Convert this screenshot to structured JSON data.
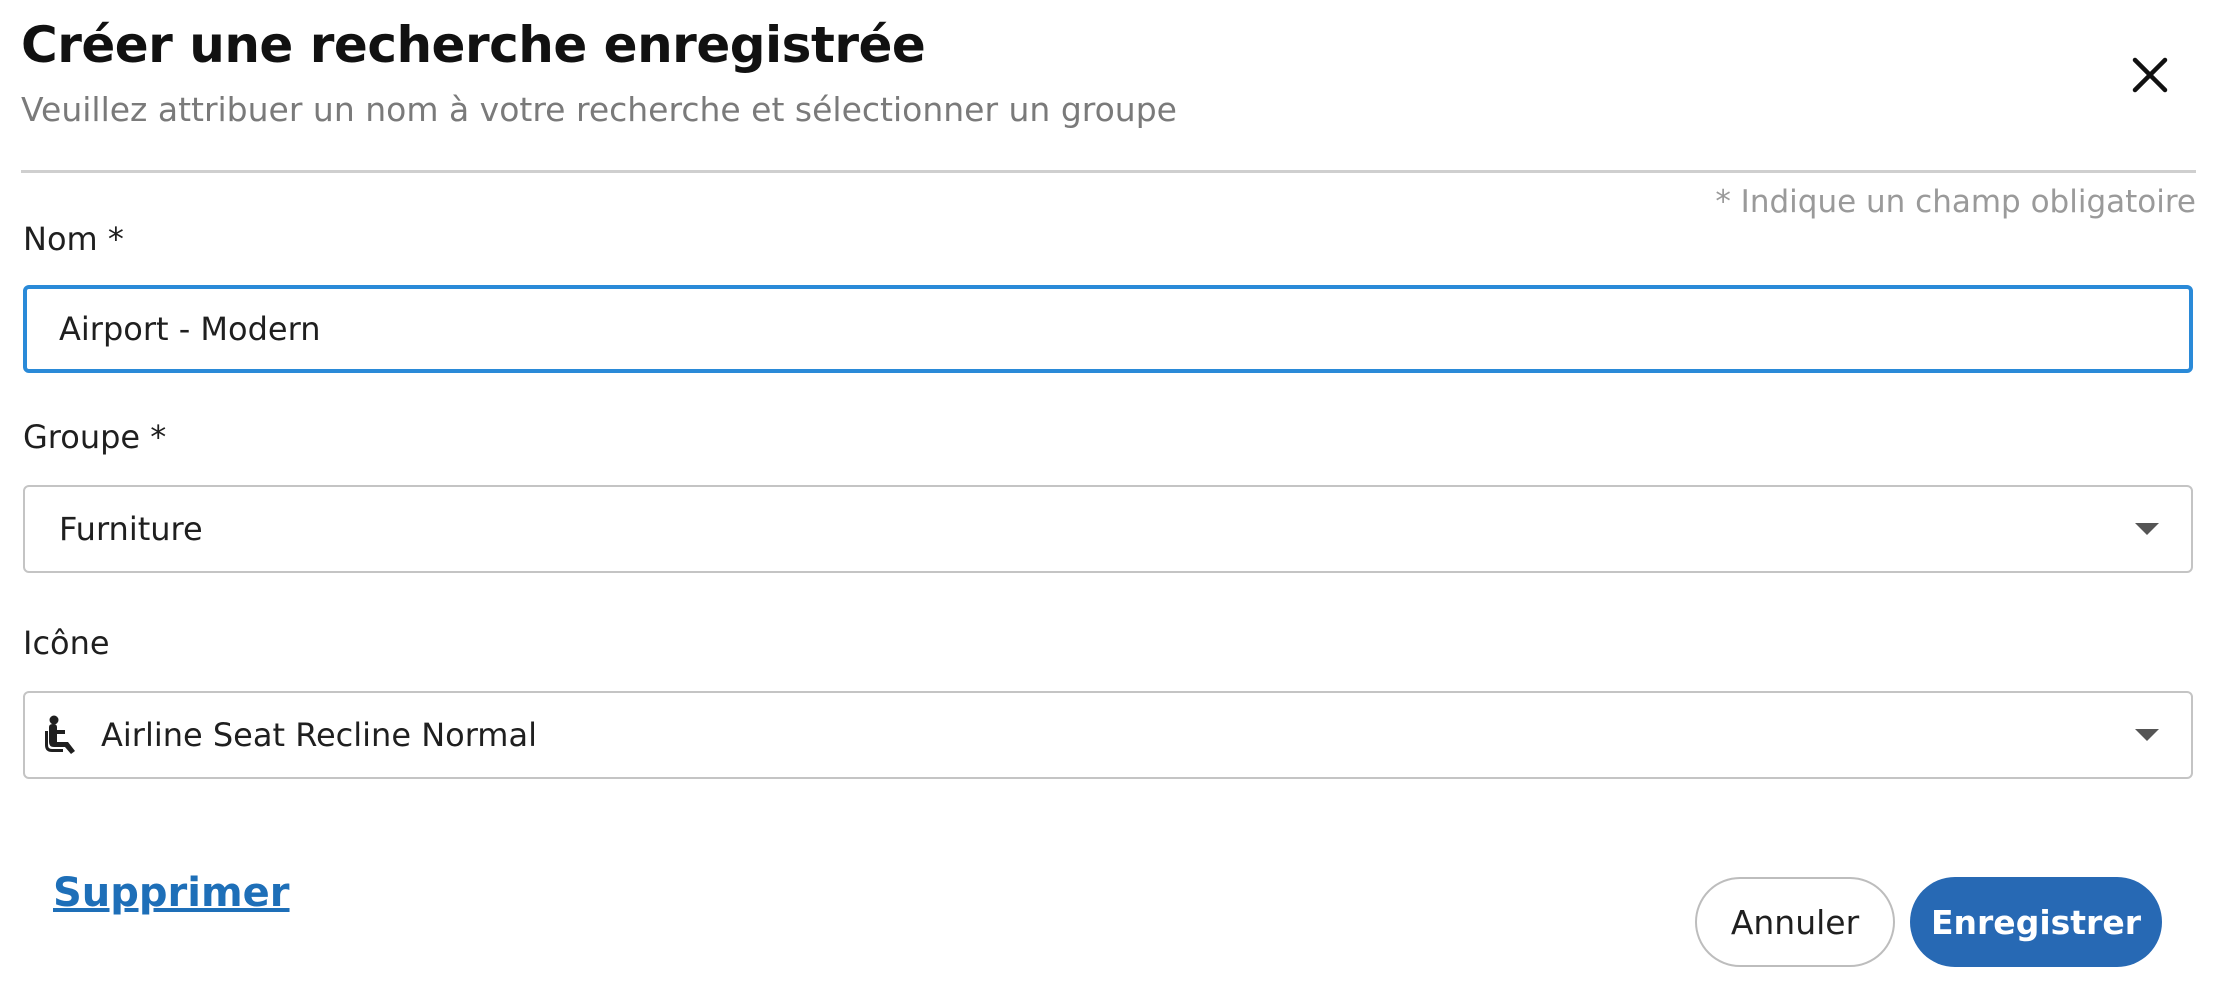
{
  "dialog": {
    "title": "Créer une recherche enregistrée",
    "subtitle": "Veuillez attribuer un nom à votre recherche et sélectionner un groupe",
    "close_icon": "close-icon",
    "required_note": "* Indique un champ obligatoire"
  },
  "fields": {
    "name": {
      "label": "Nom *",
      "value": "Airport - Modern"
    },
    "group": {
      "label": "Groupe *",
      "selected": "Furniture"
    },
    "icon": {
      "label": "Icône",
      "selected": "Airline Seat Recline Normal",
      "selected_icon": "airline-seat-recline-normal-icon"
    }
  },
  "actions": {
    "delete_label": "Supprimer",
    "cancel_label": "Annuler",
    "save_label": "Enregistrer"
  },
  "colors": {
    "accent": "#2769b4",
    "focus_border": "#2a8ad8",
    "link": "#1e6fb8",
    "muted_text": "#7a7a7a"
  }
}
